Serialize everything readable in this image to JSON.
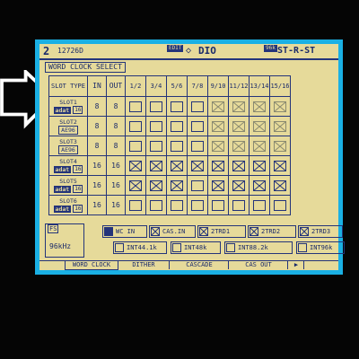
{
  "header": {
    "scene_number": "2",
    "scene_name": "12726D",
    "edit_tag": "EDIT",
    "section": "DIO",
    "lib_tag": "96k",
    "lib_name": "ST-R-ST"
  },
  "page": {
    "title": "WORD CLOCK SELECT"
  },
  "table": {
    "headers": {
      "slot": "SLOT TYPE",
      "in": "IN",
      "out": "OUT"
    },
    "columns": [
      "1/2",
      "3/4",
      "5/6",
      "7/8",
      "9/10",
      "11/12",
      "13/14",
      "15/16"
    ],
    "rows": [
      {
        "slot": "SLOT1",
        "card": "adat",
        "chan": "16",
        "in": "8",
        "out": "8",
        "cells": [
          "empty",
          "empty",
          "empty",
          "empty",
          "na",
          "na",
          "na",
          "na"
        ]
      },
      {
        "slot": "SLOT2",
        "card": "AE96",
        "chan": "",
        "in": "8",
        "out": "8",
        "cells": [
          "empty",
          "empty",
          "empty",
          "empty",
          "na",
          "na",
          "na",
          "na"
        ]
      },
      {
        "slot": "SLOT3",
        "card": "AE96",
        "chan": "",
        "in": "8",
        "out": "8",
        "cells": [
          "empty",
          "empty",
          "empty",
          "empty",
          "na",
          "na",
          "na",
          "na"
        ]
      },
      {
        "slot": "SLOT4",
        "card": "adat",
        "chan": "16",
        "in": "16",
        "out": "16",
        "cells": [
          "x",
          "x",
          "x",
          "x",
          "x",
          "x",
          "x",
          "x"
        ]
      },
      {
        "slot": "SLOT5",
        "card": "adat",
        "chan": "16",
        "in": "16",
        "out": "16",
        "cells": [
          "x",
          "x",
          "x",
          "empty",
          "x",
          "x",
          "x",
          "x"
        ]
      },
      {
        "slot": "SLOT6",
        "card": "adat",
        "chan": "16",
        "in": "16",
        "out": "16",
        "cells": [
          "empty",
          "empty",
          "empty",
          "empty",
          "empty",
          "empty",
          "empty",
          "empty"
        ]
      }
    ]
  },
  "fs": {
    "label": "FS",
    "value": "96kHz"
  },
  "sources_row1": [
    {
      "label": "WC IN",
      "state": "selected"
    },
    {
      "label": "CAS.IN",
      "state": "x"
    },
    {
      "label": "2TRD1",
      "state": "x"
    },
    {
      "label": "2TRD2",
      "state": "x"
    },
    {
      "label": "2TRD3",
      "state": "x"
    }
  ],
  "sources_row2": [
    {
      "label": "INT44.1k",
      "state": "empty"
    },
    {
      "label": "INT48k",
      "state": "empty"
    },
    {
      "label": "INT88.2k",
      "state": "empty"
    },
    {
      "label": "INT96k",
      "state": "empty"
    }
  ],
  "tabs": [
    "WORD CLOCK",
    "DITHER",
    "CASCADE",
    "CAS OUT",
    "▶"
  ],
  "colors": {
    "lcd_bg": "#e6da9a",
    "ink": "#1a2a6a",
    "bezel": "#1ab0e4",
    "arrow": "#ffffff"
  }
}
